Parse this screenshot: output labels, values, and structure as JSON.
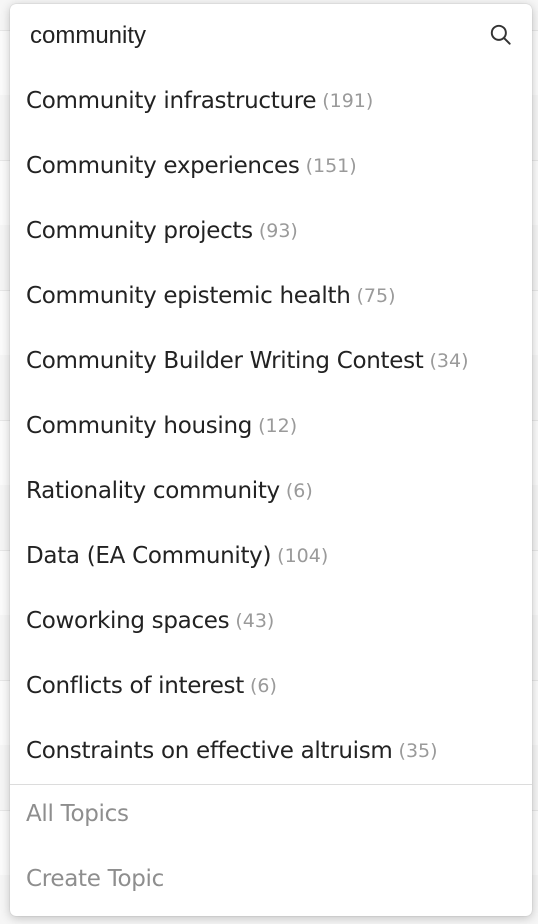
{
  "search": {
    "value": "community",
    "icon": "search-icon"
  },
  "results": [
    {
      "name": "Community infrastructure",
      "count": "(191)"
    },
    {
      "name": "Community experiences",
      "count": "(151)"
    },
    {
      "name": "Community projects",
      "count": "(93)"
    },
    {
      "name": "Community epistemic health",
      "count": "(75)"
    },
    {
      "name": "Community Builder Writing Contest",
      "count": "(34)"
    },
    {
      "name": "Community housing",
      "count": "(12)"
    },
    {
      "name": "Rationality community",
      "count": "(6)"
    },
    {
      "name": "Data (EA Community)",
      "count": "(104)"
    },
    {
      "name": "Coworking spaces",
      "count": "(43)"
    },
    {
      "name": "Conflicts of interest",
      "count": "(6)"
    },
    {
      "name": "Constraints on effective altruism",
      "count": "(35)"
    }
  ],
  "footer": {
    "all_topics": "All Topics",
    "create_topic": "Create Topic"
  }
}
